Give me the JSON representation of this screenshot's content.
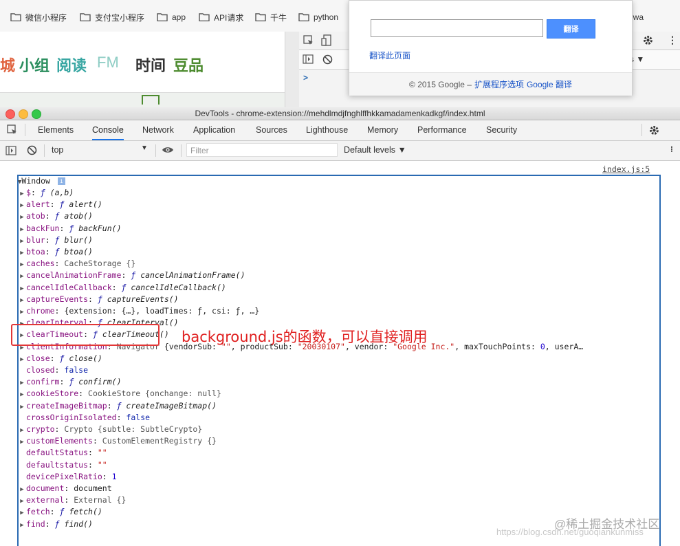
{
  "bookmarks": [
    {
      "label": "微信小程序",
      "icon": "folder-icon"
    },
    {
      "label": "支付宝小程序",
      "icon": "folder-icon"
    },
    {
      "label": "app",
      "icon": "folder-icon"
    },
    {
      "label": "API请求",
      "icon": "folder-icon"
    },
    {
      "label": "千牛",
      "icon": "folder-icon"
    },
    {
      "label": "python",
      "icon": "folder-icon"
    },
    {
      "label": "iwa",
      "icon": ""
    }
  ],
  "site_nav": [
    "城",
    "小组",
    "阅读",
    "FM",
    "时间",
    "豆品"
  ],
  "colors": {
    "nav_red": "#e0633e",
    "nav_green": "#2b8e5e",
    "nav_teal": "#37a6a2",
    "nav_fm": "#8ecdc4",
    "nav_dark": "#333333",
    "nav_olive": "#4d8b2f",
    "accent": "#1a73e8",
    "annotation": "#e02020",
    "object_border": "#2a6ab2"
  },
  "translate_popup": {
    "button": "翻译",
    "link": "翻译此页面",
    "footer_prefix": "© 2015 Google –",
    "footer_link1": "扩展程序选项",
    "footer_link2": "Google 翻译"
  },
  "mini_devtools": {
    "dropdown": "s ▼",
    "prompt": ">"
  },
  "devtools": {
    "title": "DevTools - chrome-extension://mehdlmdjfnghlffhkkamadamenkadkgf/index.html",
    "tabs": [
      "Elements",
      "Console",
      "Network",
      "Application",
      "Sources",
      "Lighthouse",
      "Memory",
      "Performance",
      "Security"
    ],
    "active_tab": "Console",
    "context": "top",
    "filter_placeholder": "Filter",
    "levels": "Default levels ▼",
    "source_link": "index.js:5",
    "root": "Window",
    "info_badge": "i"
  },
  "console_lines": [
    {
      "expand": true,
      "key": "$",
      "kind": "fn",
      "value": "(a,b)"
    },
    {
      "expand": true,
      "key": "alert",
      "kind": "fn",
      "value": "alert()"
    },
    {
      "expand": true,
      "key": "atob",
      "kind": "fn",
      "value": "atob()"
    },
    {
      "expand": true,
      "key": "backFun",
      "kind": "fn",
      "value": "backFun()"
    },
    {
      "expand": true,
      "key": "blur",
      "kind": "fn",
      "value": "blur()"
    },
    {
      "expand": true,
      "key": "btoa",
      "kind": "fn",
      "value": "btoa()"
    },
    {
      "expand": true,
      "key": "caches",
      "kind": "obj",
      "value": "CacheStorage {}"
    },
    {
      "expand": true,
      "key": "cancelAnimationFrame",
      "kind": "fn",
      "value": "cancelAnimationFrame()"
    },
    {
      "expand": true,
      "key": "cancelIdleCallback",
      "kind": "fn",
      "value": "cancelIdleCallback()"
    },
    {
      "expand": true,
      "key": "captureEvents",
      "kind": "fn",
      "value": "captureEvents()"
    },
    {
      "expand": true,
      "key": "chrome",
      "kind": "plain",
      "value": "{extension: {…}, loadTimes: ƒ, csi: ƒ, …}"
    },
    {
      "expand": true,
      "key": "clearInterval",
      "kind": "fn",
      "value": "clearInterval()"
    },
    {
      "expand": true,
      "key": "clearTimeout",
      "kind": "fn",
      "value": "clearTimeout()"
    },
    {
      "expand": true,
      "key": "clientInformation",
      "kind": "navigator",
      "value": ""
    },
    {
      "expand": true,
      "key": "close",
      "kind": "fn",
      "value": "close()"
    },
    {
      "expand": false,
      "key": "closed",
      "kind": "kw",
      "value": "false"
    },
    {
      "expand": true,
      "key": "confirm",
      "kind": "fn",
      "value": "confirm()"
    },
    {
      "expand": true,
      "key": "cookieStore",
      "kind": "obj",
      "value": "CookieStore {onchange: null}"
    },
    {
      "expand": true,
      "key": "createImageBitmap",
      "kind": "fn",
      "value": "createImageBitmap()"
    },
    {
      "expand": false,
      "key": "crossOriginIsolated",
      "kind": "kw",
      "value": "false"
    },
    {
      "expand": true,
      "key": "crypto",
      "kind": "obj",
      "value": "Crypto {subtle: SubtleCrypto}"
    },
    {
      "expand": true,
      "key": "customElements",
      "kind": "obj",
      "value": "CustomElementRegistry {}"
    },
    {
      "expand": false,
      "key": "defaultStatus",
      "kind": "str",
      "value": "\"\""
    },
    {
      "expand": false,
      "key": "defaultstatus",
      "kind": "str",
      "value": "\"\""
    },
    {
      "expand": false,
      "key": "devicePixelRatio",
      "kind": "num",
      "value": "1"
    },
    {
      "expand": true,
      "key": "document",
      "kind": "plain",
      "value": "document"
    },
    {
      "expand": true,
      "key": "external",
      "kind": "obj",
      "value": "External {}"
    },
    {
      "expand": true,
      "key": "fetch",
      "kind": "fn",
      "value": "fetch()"
    },
    {
      "expand": true,
      "key": "find",
      "kind": "fn",
      "value": "find()"
    }
  ],
  "navigator_line": {
    "type": "Navigator",
    "prefix": "{vendorSub: ",
    "vendorSub": "\"\"",
    "mid1": ", productSub: ",
    "productSub": "\"20030107\"",
    "mid2": ", vendor: ",
    "vendor": "\"Google Inc.\"",
    "mid3": ", maxTouchPoints: ",
    "maxTouchPoints": "0",
    "tail": ", userA…"
  },
  "annotation": "background.js的函数，可以直接调用",
  "watermark": "@稀土掘金技术社区",
  "watermark_url": "https://blog.csdn.net/guoqiankunmiss"
}
